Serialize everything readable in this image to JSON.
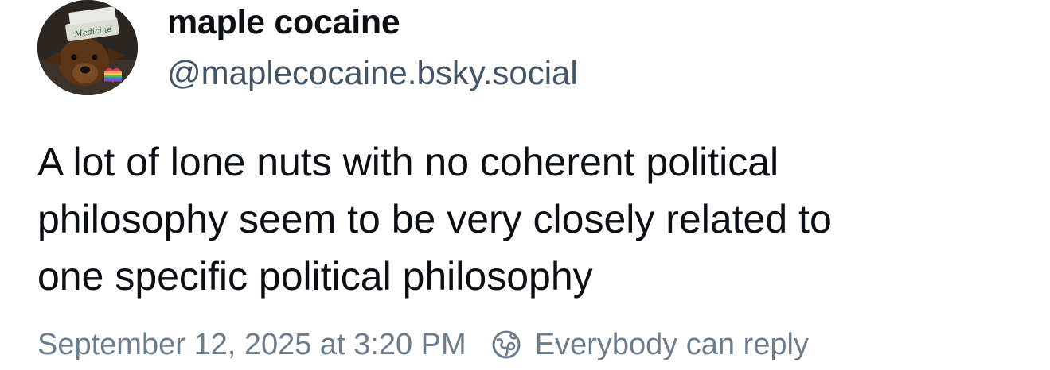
{
  "author": {
    "display_name": "maple cocaine",
    "handle": "@maplecocaine.bsky.social",
    "avatar_icon": "dog-with-hat-avatar",
    "avatar_hat_text": "Medicine"
  },
  "post": {
    "lines": [
      "A lot of lone nuts with no coherent political",
      "philosophy seem to be very closely related to",
      "one specific political philosophy"
    ]
  },
  "meta": {
    "timestamp": "September 12, 2025 at 3:20 PM",
    "reply_setting_label": "Everybody can reply",
    "reply_setting_icon": "globe-reply-icon"
  },
  "colors": {
    "text_primary": "#0b0f14",
    "text_secondary": "#425466",
    "text_meta": "#6b7c8c",
    "background": "#ffffff"
  }
}
